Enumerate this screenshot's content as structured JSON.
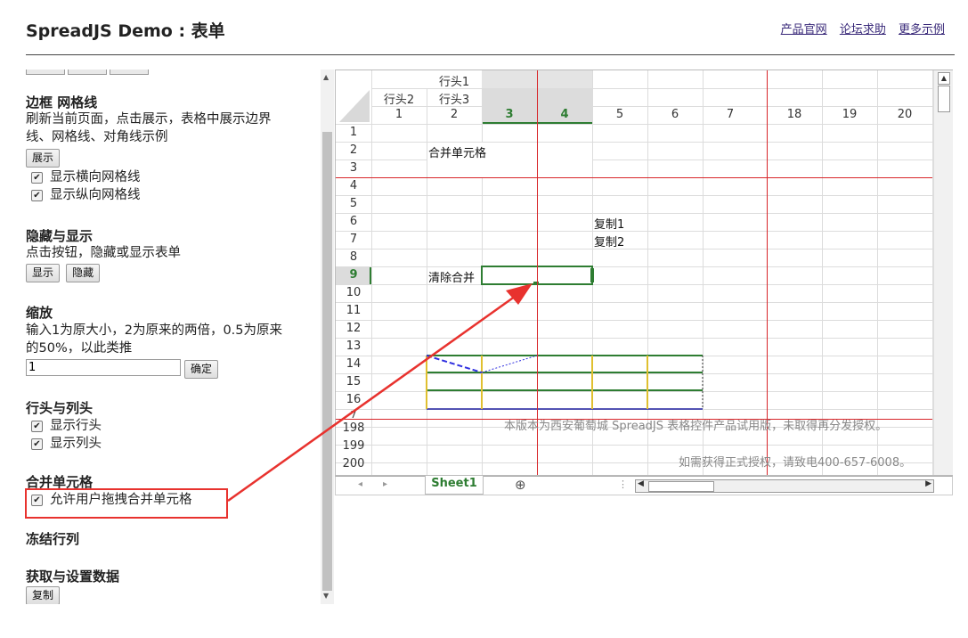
{
  "header": {
    "title": "SpreadJS Demo : 表单",
    "links": [
      "产品官网",
      "论坛求助",
      "更多示例"
    ]
  },
  "panel": {
    "sections": [
      {
        "title": "边框 网格线",
        "desc": "刷新当前页面，点击展示，表格中展示边界线、网格线、对角线示例",
        "buttons": [
          "展示"
        ],
        "checks": [
          "显示横向网格线",
          "显示纵向网格线"
        ]
      },
      {
        "title": "隐藏与显示",
        "desc": "点击按钮，隐藏或显示表单",
        "buttons": [
          "显示",
          "隐藏"
        ]
      },
      {
        "title": "缩放",
        "desc": "输入1为原大小，2为原来的两倍，0.5为原来的50%，以此类推",
        "input_value": "1",
        "buttons": [
          "确定"
        ]
      },
      {
        "title": "行头与列头",
        "checks": [
          "显示行头",
          "显示列头"
        ]
      },
      {
        "title": "合并单元格",
        "checks": [
          "允许用户拖拽合并单元格"
        ]
      },
      {
        "title": "冻结行列"
      },
      {
        "title": "获取与设置数据",
        "buttons": [
          "复制"
        ]
      }
    ]
  },
  "sheet": {
    "col_header_row1": [
      "行头1"
    ],
    "col_header_row2": [
      "行头2",
      "行头3"
    ],
    "col_numbers": [
      "1",
      "2",
      "3",
      "4",
      "5",
      "6",
      "7",
      "18",
      "19",
      "20"
    ],
    "row_numbers": [
      "1",
      "2",
      "3",
      "4",
      "5",
      "6",
      "7",
      "8",
      "9",
      "10",
      "11",
      "12",
      "13",
      "14",
      "15",
      "16",
      "7",
      "198",
      "199",
      "200"
    ],
    "cells": {
      "merge": "合并单元格",
      "copy1": "复制1",
      "copy2": "复制2",
      "clear": "清除合并"
    },
    "watermark1": "本版本为西安葡萄城 SpreadJS 表格控件产品试用版，未取得再分发授权。",
    "watermark2": "如需获得正式授权，请致电400-657-6008。",
    "tab": "Sheet1",
    "colors": {
      "accent": "#2e7d32",
      "red": "#d8262a"
    }
  }
}
